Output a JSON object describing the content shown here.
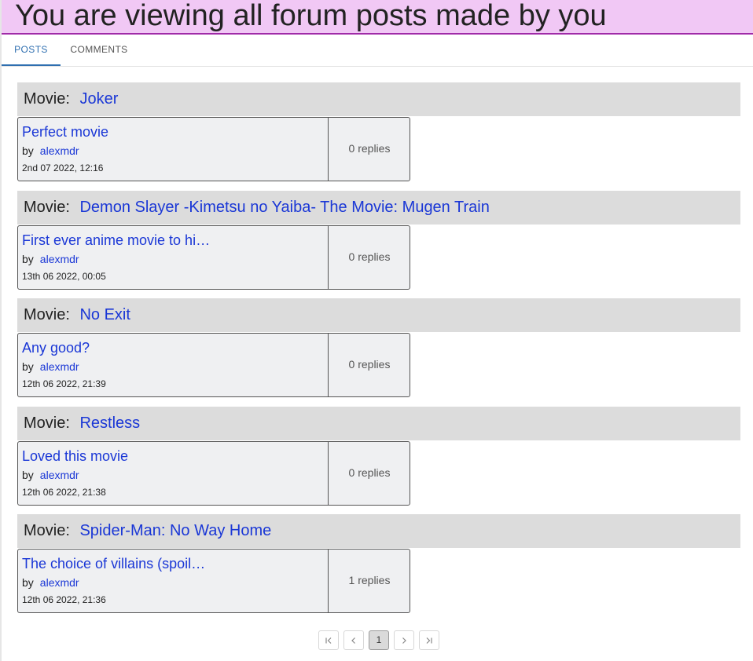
{
  "banner": {
    "title": "You are viewing all forum posts made by you"
  },
  "tabs": [
    {
      "label": "POSTS",
      "active": true
    },
    {
      "label": "COMMENTS",
      "active": false
    }
  ],
  "movie_prefix": "Movie:",
  "by_label": "by",
  "groups": [
    {
      "movie": "Joker",
      "post": {
        "title": "Perfect movie",
        "author": "alexmdr",
        "date": "2nd 07 2022, 12:16",
        "replies": "0 replies"
      }
    },
    {
      "movie": "Demon Slayer -Kimetsu no Yaiba- The Movie: Mugen Train",
      "post": {
        "title": "First ever anime movie to hi…",
        "author": "alexmdr",
        "date": "13th 06 2022, 00:05",
        "replies": "0 replies"
      }
    },
    {
      "movie": "No Exit",
      "post": {
        "title": "Any good?",
        "author": "alexmdr",
        "date": "12th 06 2022, 21:39",
        "replies": "0 replies"
      }
    },
    {
      "movie": "Restless",
      "post": {
        "title": "Loved this movie",
        "author": "alexmdr",
        "date": "12th 06 2022, 21:38",
        "replies": "0 replies"
      }
    },
    {
      "movie": "Spider-Man: No Way Home",
      "post": {
        "title": "The choice of villains (spoil…",
        "author": "alexmdr",
        "date": "12th 06 2022, 21:36",
        "replies": "1 replies"
      }
    }
  ],
  "pagination": {
    "first_icon": "first-page-icon",
    "prev_icon": "previous-page-icon",
    "current_page": "1",
    "next_icon": "next-page-icon",
    "last_icon": "last-page-icon"
  },
  "colors": {
    "banner_bg": "#f1c8f5",
    "banner_border": "#a02aa8",
    "link": "#1a37d6",
    "active_tab": "#2f6fb0",
    "group_header_bg": "#dcdcdc",
    "card_bg": "#eff0f2"
  }
}
